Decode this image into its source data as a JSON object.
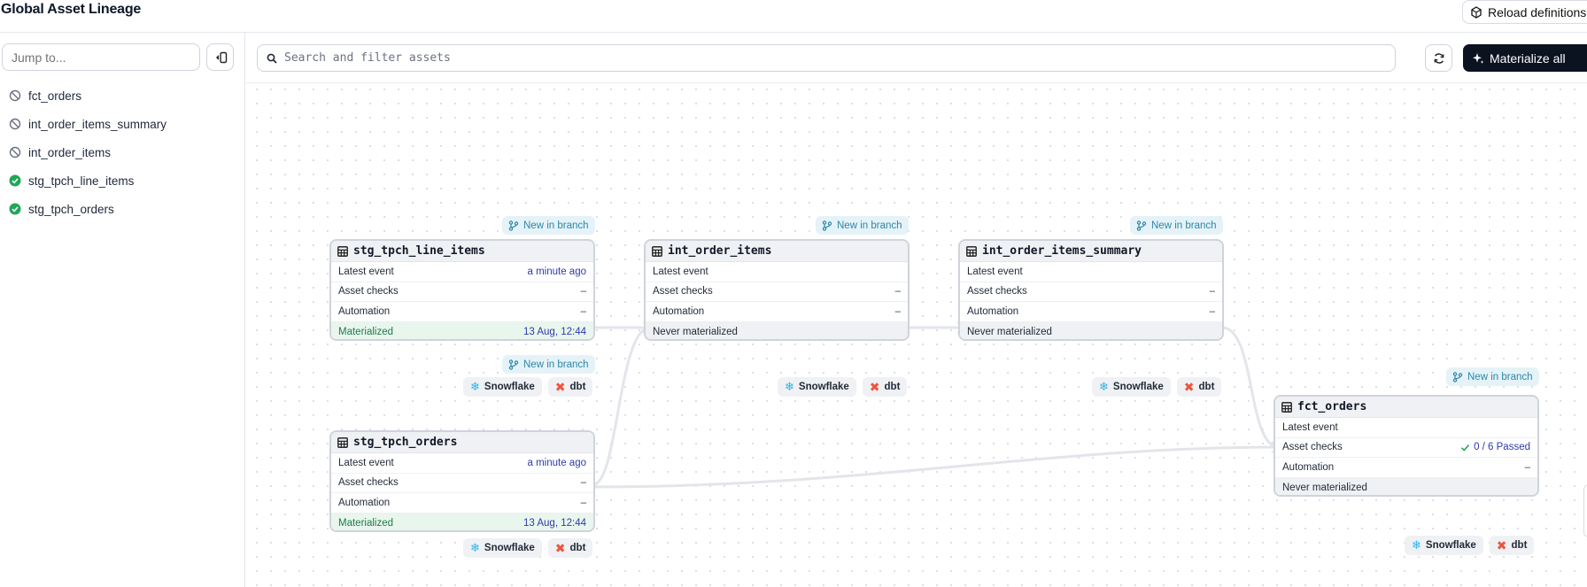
{
  "page": {
    "title": "Global Asset Lineage",
    "reload_label": "Reload definitions"
  },
  "sidebar": {
    "jump_placeholder": "Jump to...",
    "items": [
      {
        "label": "fct_orders",
        "status": "never-materialized"
      },
      {
        "label": "int_order_items_summary",
        "status": "never-materialized"
      },
      {
        "label": "int_order_items",
        "status": "never-materialized"
      },
      {
        "label": "stg_tpch_line_items",
        "status": "materialized"
      },
      {
        "label": "stg_tpch_orders",
        "status": "materialized"
      }
    ]
  },
  "toolbar": {
    "search_placeholder": "Search and filter assets",
    "materialize_label": "Materialize all"
  },
  "labels": {
    "new_in_branch": "New in branch",
    "latest_event": "Latest event",
    "asset_checks": "Asset checks",
    "automation": "Automation",
    "snowflake": "Snowflake",
    "dbt": "dbt"
  },
  "nodes": {
    "stg_tpch_line_items": {
      "name": "stg_tpch_line_items",
      "latest_event": "a minute ago",
      "asset_checks": "–",
      "automation": "–",
      "status": "Materialized",
      "status_time": "13 Aug, 12:44"
    },
    "stg_tpch_orders": {
      "name": "stg_tpch_orders",
      "latest_event": "a minute ago",
      "asset_checks": "–",
      "automation": "–",
      "status": "Materialized",
      "status_time": "13 Aug, 12:44"
    },
    "int_order_items": {
      "name": "int_order_items",
      "latest_event": "",
      "asset_checks": "–",
      "automation": "–",
      "status": "Never materialized",
      "status_time": ""
    },
    "int_order_items_summary": {
      "name": "int_order_items_summary",
      "latest_event": "",
      "asset_checks": "–",
      "automation": "–",
      "status": "Never materialized",
      "status_time": ""
    },
    "fct_orders": {
      "name": "fct_orders",
      "latest_event": "",
      "asset_checks": "0 / 6 Passed",
      "automation": "–",
      "status": "Never materialized",
      "status_time": ""
    }
  },
  "colors": {
    "accent": "#0b1220",
    "materialized": "#1f9d55",
    "branch": "#2e86a8",
    "dbt": "#f0543c",
    "snowflake": "#29b5e8"
  }
}
